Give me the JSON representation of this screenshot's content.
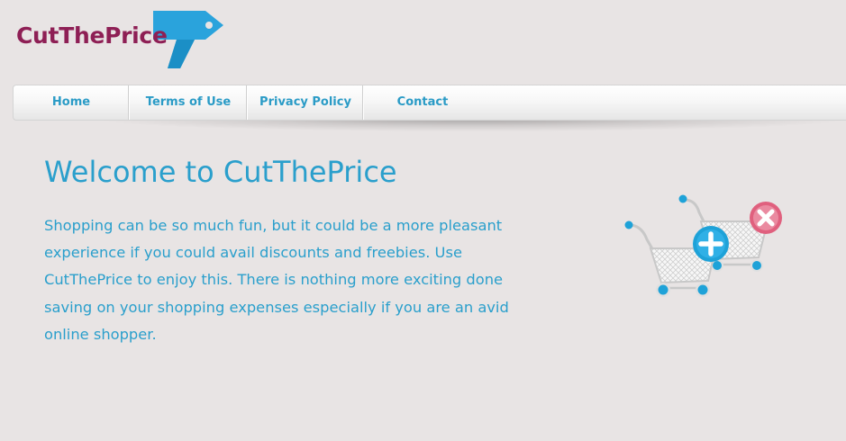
{
  "logo": {
    "text": "CutThePrice",
    "icon": "price-tag-icon",
    "text_color": "#8e1f55",
    "tag_color": "#2aa3dc"
  },
  "nav": {
    "items": [
      {
        "label": "Home"
      },
      {
        "label": "Terms of Use"
      },
      {
        "label": "Privacy Policy"
      },
      {
        "label": "Contact"
      }
    ],
    "text_color": "#2a9bc6"
  },
  "main": {
    "title": "Welcome to CutThePrice",
    "paragraph": "Shopping can be so much fun, but it could be a more pleasant experience if you could avail discounts and freebies. Use CutThePrice to enjoy this. There is nothing more exciting done saving on your shopping expenses especially if you are an avid online shopper.",
    "text_color": "#2a9fcc"
  },
  "illustration": {
    "icons": [
      "shopping-cart-add-icon",
      "shopping-cart-remove-icon"
    ],
    "add_color": "#1ea2d8",
    "remove_color": "#e0607e"
  },
  "page": {
    "background": "#e8e4e4"
  }
}
